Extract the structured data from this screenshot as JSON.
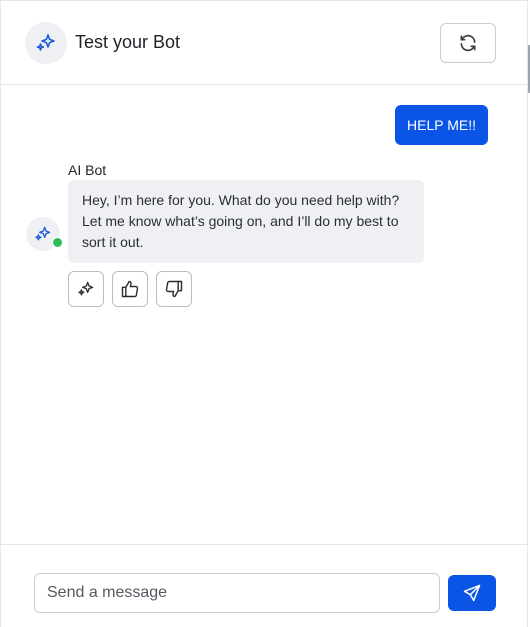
{
  "header": {
    "title": "Test your Bot",
    "avatar_icon": "sparkle-icon",
    "refresh_icon": "refresh-icon"
  },
  "conversation": {
    "user_message": "HELP ME!!",
    "bot_name": "AI Bot",
    "bot_message": "Hey, I’m here for you. What do you need help with? Let me know what’s going on, and I’ll do my best to sort it out.",
    "bot_status": "online",
    "actions": [
      "sparkle-icon",
      "thumbs-up-icon",
      "thumbs-down-icon"
    ]
  },
  "composer": {
    "placeholder": "Send a message",
    "value": "",
    "send_icon": "send-icon"
  },
  "colors": {
    "accent": "#0b55e6",
    "online": "#2ebd59",
    "bot_bubble": "#eff0f3"
  }
}
